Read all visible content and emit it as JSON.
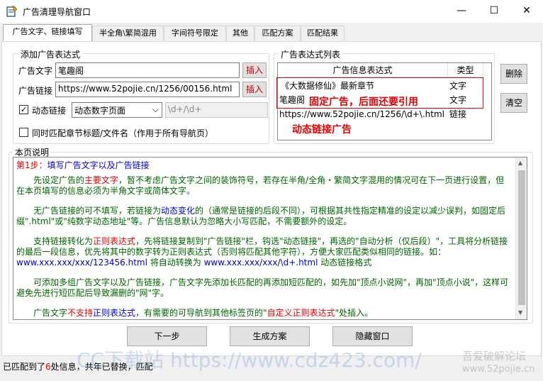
{
  "window": {
    "title": "广告清理导航窗口",
    "controls": [
      "—",
      "☐",
      "✕"
    ]
  },
  "tabs": [
    {
      "label": "广告文字、链接填写",
      "active": true
    },
    {
      "label": "半全角\\繁简混用"
    },
    {
      "label": "字间符号限定"
    },
    {
      "label": "其他"
    },
    {
      "label": "匹配方案"
    },
    {
      "label": "匹配结果"
    }
  ],
  "add_group": {
    "legend": "添加广告表达式",
    "ad_text_label": "广告文字",
    "ad_text_value": "笔趣阁",
    "ad_link_label": "广告链接",
    "ad_link_value": "https://www.52pojie.cn/1256/00156.html",
    "insert_label": "插入",
    "dynamic_link_label": "动态链接",
    "dynamic_link_checked": true,
    "dynamic_select_value": "动态数字页面",
    "regex_value": "\\d+/\\d+",
    "same_match_label": "同时匹配章节标题/文件名（作用于所有导航页）",
    "same_match_checked": false
  },
  "list_group": {
    "legend": "广告表达式列表",
    "col_expr": "广告信息表达式",
    "col_type": "类型",
    "rows": [
      {
        "expr": "《大数据修仙》最新章节",
        "type": "文字"
      },
      {
        "expr": "笔趣阁",
        "type": "文字"
      },
      {
        "expr": "https://www.52pojie.cn/1256/\\d+\\.html",
        "type": "链接"
      }
    ],
    "annotation_fixed": "固定广告，后面还要引用",
    "annotation_dynamic": "动态链接广告",
    "delete_label": "删除",
    "clear_label": "清空"
  },
  "desc_group": {
    "legend": "本页说明",
    "step_label": "第1步：",
    "step_text": "填写广告文字以及广告链接",
    "p1_a": "先设定广告的",
    "p1_red": "主要文字",
    "p1_b": "，暂不考虑广告文字之间的装饰符号，若存在半角/全角・繁简文字混用的情况可在下一页进行设置，但在本页填写的信息必须为半角文字或简体文字。",
    "p2_a": "无广告链接的可不填写，若链接为",
    "p2_blue": "动态变化",
    "p2_b": "的（通常是链接的后段不同），可根据其共性指定精准的设定以减少误判，如固定后缀\".html\"或\"纯数字动态地址\"等。广告信息默认为忽略大小写匹配，不需要额外的设定。",
    "p3_a": "支持链接转化为",
    "p3_red": "正则表达式",
    "p3_b": "，先将链接复制到\"广告链接\"栏，钩选\"动态链接\"，再选的\"自动分析（仅后段）\"，工具将分析链接的最后一段信息，优先将其中的数字转为正则表达式（否则将匹配其他字符），方便大家匹配类似相同的链接。如：",
    "p3_link1": "www.xxx.xxx/xxx/123456.html",
    "p3_c": " 将自动转换为 ",
    "p3_link2": "www.xxx.xxx/xxx/\\d+.html",
    "p3_d": " 动态链接格式",
    "p4": "可添加多组广告文字以及广告链接，广告文字先添加长匹配的再添加短匹配的，如先加\"顶点小说网\"，再加\"顶点小说\"，这样可避免先进行短匹配后导致漏删的\"网\"字。",
    "p5_a": "广告文字",
    "p5_red1": "不支持",
    "p5_blue": "正则表达式",
    "p5_b": "，有需要的可导航到其他标签页的\"",
    "p5_red2": "自定义正则表达式",
    "p5_c": "\"处插入。"
  },
  "buttons": {
    "next": "下一步",
    "generate": "生成方案",
    "hide": "隐藏窗口"
  },
  "status": {
    "prefix": "已匹配到了",
    "count": "6",
    "suffix": "处信息，共年已替换，匹配"
  },
  "watermarks": {
    "left": "CC下载站 https://www.cdz423.com/",
    "right_top": "吾爱破解论坛",
    "right_bottom": "www.52pojie.cn"
  }
}
